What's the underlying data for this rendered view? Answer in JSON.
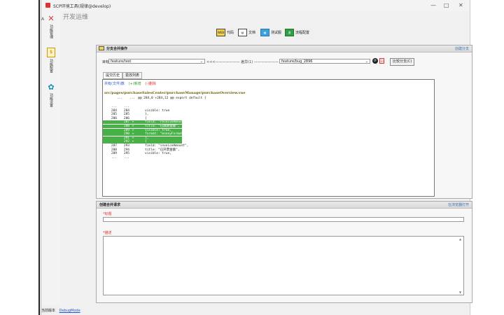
{
  "window": {
    "title": "SCP环境工具(规律@develop)",
    "controls": [
      "—",
      "□",
      "✕"
    ]
  },
  "sidebar": {
    "items": [
      {
        "label": "功能管理",
        "icon": "tools-icon"
      },
      {
        "label": "功能配置",
        "icon": "document-icon"
      },
      {
        "label": "功能设置",
        "icon": "gear-icon"
      }
    ]
  },
  "section_title": "开发运维",
  "toolbar": {
    "items": [
      {
        "label": "代码",
        "icon": "code-icon"
      },
      {
        "label": "文档",
        "icon": "doc-icon"
      },
      {
        "label": "测试服",
        "icon": "server-icon"
      },
      {
        "label": "流程配置",
        "icon": "flow-icon"
      }
    ]
  },
  "branch_panel": {
    "header": "分支合并操作",
    "header_action": "创建分支",
    "source_label": "目标",
    "source_value": "feature/test",
    "arrow_text": "<<<——————— 差异(1) ———————",
    "target_value": "feature/bug_2896",
    "compare_button": "比较分支(C)",
    "tabs": [
      "提交历史",
      "更改列表"
    ],
    "legend": {
      "changed": "共有(文件)数",
      "added": "(+)新增",
      "deleted": "(-)删除"
    },
    "file_path": "src/pages/purchaseSalesCenter/purchaseManage/purchaseOverview.vue",
    "hunk_header": "@@ 284,0 +284,12 @@ export default {",
    "lines": [
      {
        "old": "...",
        "new": "...",
        "mark": "",
        "text": "",
        "type": "ctx"
      },
      {
        "old": "284",
        "new": "284",
        "mark": "",
        "text": "visible: true",
        "type": "ctx"
      },
      {
        "old": "285",
        "new": "285",
        "mark": "",
        "text": "},",
        "type": "ctx"
      },
      {
        "old": "286",
        "new": "286",
        "mark": "",
        "text": "{",
        "type": "ctx"
      },
      {
        "old": "",
        "new": "287",
        "mark": "+",
        "text": "field: \"receiveAmount\",",
        "type": "add"
      },
      {
        "old": "",
        "new": "288",
        "mark": "+",
        "text": "title: \"已收款金额\",",
        "type": "add"
      },
      {
        "old": "",
        "new": "289",
        "mark": "+",
        "text": "visible: true,",
        "type": "add"
      },
      {
        "old": "",
        "new": "290",
        "mark": "+",
        "text": "format: \"moneyFormat\"",
        "type": "add"
      },
      {
        "old": "",
        "new": "291",
        "mark": "+",
        "text": "},",
        "type": "add"
      },
      {
        "old": "",
        "new": "292",
        "mark": "+",
        "text": "{",
        "type": "add"
      },
      {
        "old": "287",
        "new": "293",
        "mark": "",
        "text": "field: \"invoiceAmount\",",
        "type": "ctx"
      },
      {
        "old": "288",
        "new": "294",
        "mark": "",
        "text": "title: \"已开票金额\",",
        "type": "ctx"
      },
      {
        "old": "289",
        "new": "295",
        "mark": "",
        "text": "visible: true,",
        "type": "ctx"
      },
      {
        "old": "...",
        "new": "...",
        "mark": "",
        "text": "",
        "type": "ctx"
      }
    ]
  },
  "merge_panel": {
    "header": "创建合并请求",
    "header_action": "在浏览器打开",
    "title_label": "*标题",
    "title_value": "",
    "desc_label": "*描述",
    "desc_value": ""
  },
  "statusbar": {
    "label": "当前版本",
    "value": "DebugMode"
  },
  "colors": {
    "added_bg": "#47b047",
    "link": "#2255cc",
    "required": "#dd3333"
  }
}
